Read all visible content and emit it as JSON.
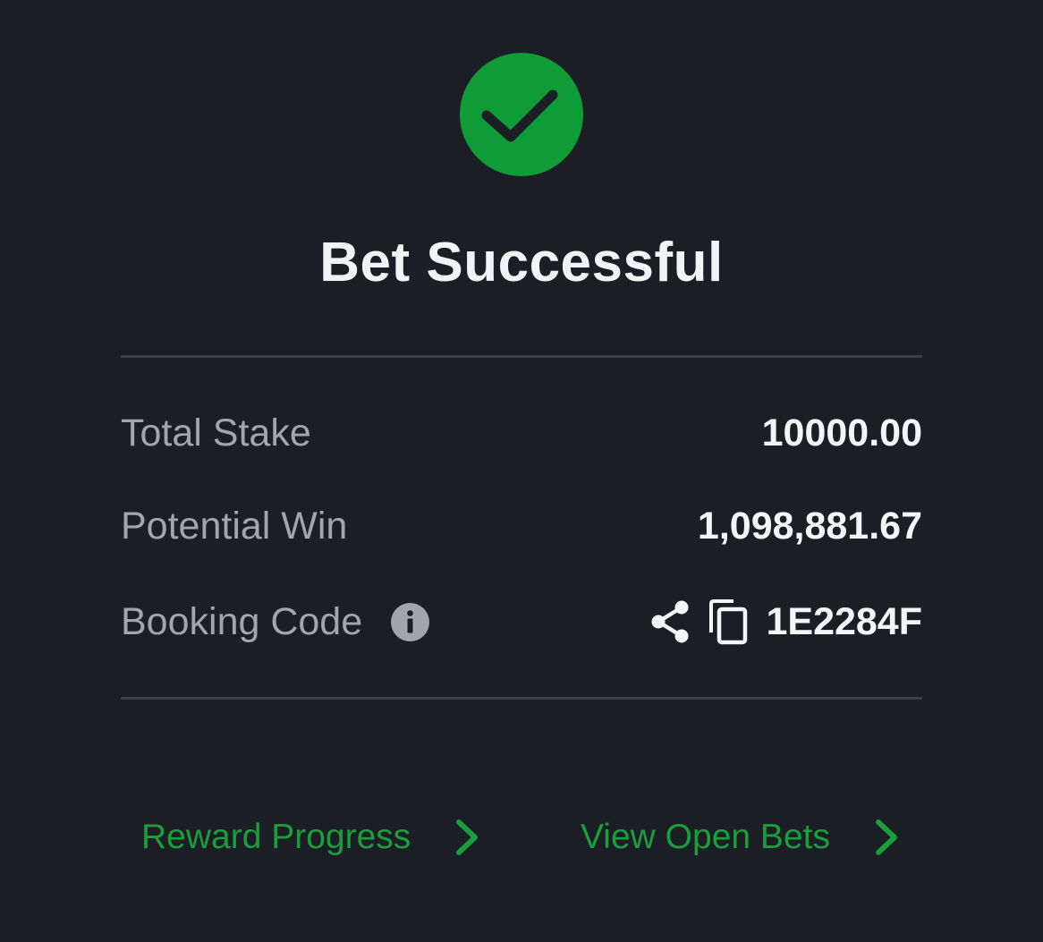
{
  "title": "Bet Successful",
  "colors": {
    "background": "#1c1e25",
    "success_green": "#0f9b35",
    "link_green": "#1a9e3b"
  },
  "icons": {
    "status": "check-circle-icon",
    "info": "info-icon",
    "share": "share-icon",
    "copy": "copy-icon",
    "link_arrow": "chevron-right-icon"
  },
  "summary": {
    "total_stake_label": "Total Stake",
    "total_stake_value": "10000.00",
    "potential_win_label": "Potential Win",
    "potential_win_value": "1,098,881.67",
    "booking_code_label": "Booking Code",
    "booking_code_value": "1E2284F"
  },
  "links": {
    "reward_progress": "Reward Progress",
    "view_open_bets": "View Open Bets"
  }
}
